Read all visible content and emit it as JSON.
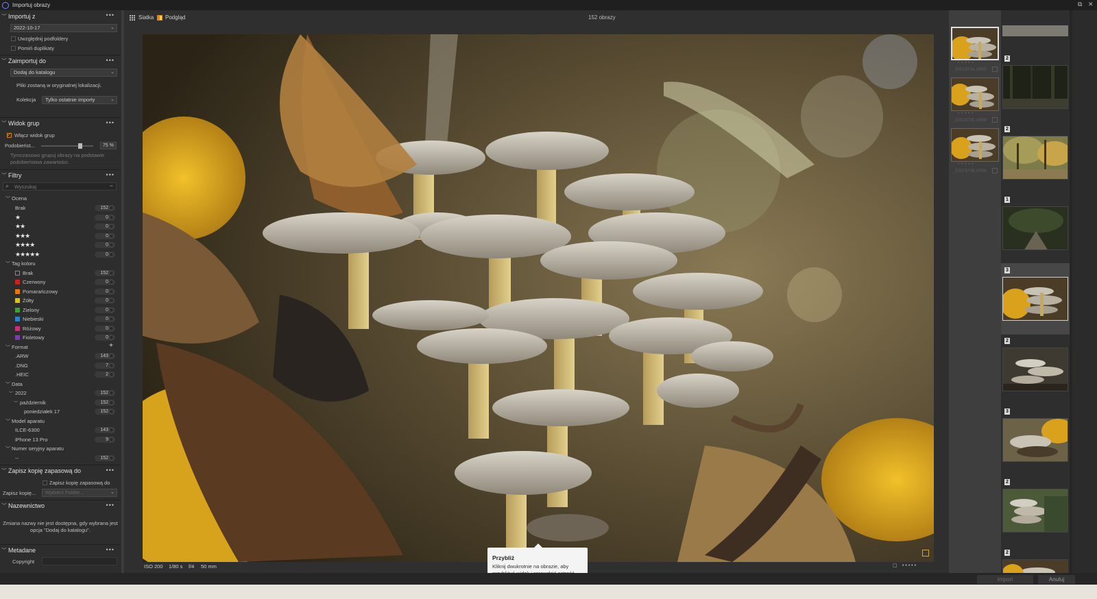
{
  "window": {
    "title": "Importuj obrazy",
    "restore": "⧉",
    "close": "✕"
  },
  "left": {
    "import_from": {
      "title": "Importuj z",
      "date_value": "2022-10-17",
      "include_subfolders": "Uwzględnij podfoldery",
      "skip_duplicates": "Pomiń duplikaty"
    },
    "import_to": {
      "title": "Zaimportuj do",
      "mode_value": "Dodaj do katalogu",
      "note": "Pliki zostaną w oryginalnej lokalizacji.",
      "collection_label": "Kolekcja",
      "collection_value": "Tylko ostatnie importy"
    },
    "group_view": {
      "title": "Widok grup",
      "enable": "Włącz widok grup",
      "similarity_label": "Podobieńst...",
      "similarity_value": "75 %",
      "similarity_level": 0.75,
      "hint": "Tymczasowo grupuj obrazy na podstawie podobieństwa zawartości."
    },
    "filters": {
      "title": "Filtry",
      "search_placeholder": "Wyszukaj",
      "rating": {
        "title": "Ocena",
        "rows": [
          {
            "label": "Brak",
            "count": "152"
          },
          {
            "stars": "★",
            "count": "0"
          },
          {
            "stars": "★★",
            "count": "0"
          },
          {
            "stars": "★★★",
            "count": "0"
          },
          {
            "stars": "★★★★",
            "count": "0"
          },
          {
            "stars": "★★★★★",
            "count": "0"
          }
        ]
      },
      "color_tag": {
        "title": "Tag koloru",
        "rows": [
          {
            "label": "Brak",
            "count": "152",
            "color": "none"
          },
          {
            "label": "Czerwony",
            "count": "0",
            "color": "#c0261e"
          },
          {
            "label": "Pomarańczowy",
            "count": "0",
            "color": "#e07a14"
          },
          {
            "label": "Żółty",
            "count": "0",
            "color": "#d9c21a"
          },
          {
            "label": "Zielony",
            "count": "0",
            "color": "#3aa135"
          },
          {
            "label": "Niebieski",
            "count": "0",
            "color": "#2f7fc8"
          },
          {
            "label": "Różowy",
            "count": "0",
            "color": "#c2337a"
          },
          {
            "label": "Fioletowy",
            "count": "0",
            "color": "#7d3ab2"
          }
        ]
      },
      "format": {
        "title": "Format",
        "rows": [
          {
            "label": ".ARW",
            "count": "143"
          },
          {
            "label": ".DNG",
            "count": "7"
          },
          {
            "label": ".HEIC",
            "count": "2"
          }
        ]
      },
      "date": {
        "title": "Data",
        "year": "2022",
        "year_count": "152",
        "month": "październik",
        "month_count": "152",
        "day": "poniedziałek 17",
        "day_count": "152"
      },
      "camera_model": {
        "title": "Model aparatu",
        "rows": [
          {
            "label": "ILCE-6300",
            "count": "143"
          },
          {
            "label": "iPhone 13 Pro",
            "count": "9"
          }
        ]
      },
      "serial": {
        "title": "Numer seryjny aparatu",
        "rows": [
          {
            "label": "--",
            "count": "152"
          }
        ]
      }
    },
    "backup": {
      "title": "Zapisz kopię zapasową do",
      "check_label": "Zapisz kopię zapasową do",
      "field_label": "Zapisz kopię...",
      "field_value": "Wybierz Folder..."
    },
    "naming": {
      "title": "Nazewnictwo",
      "note": "Zmiana nazwy nie jest dostępna, gdy wybrana jest opcja \"Dodaj do katalogu\"."
    },
    "metadata": {
      "title": "Metadane",
      "copyright_label": "Copyright"
    }
  },
  "toolbar": {
    "grid": "Siatka",
    "preview": "Podgląd",
    "count": "152 obrazy"
  },
  "exif": {
    "iso": "ISO 200",
    "shutter": "1/80 s",
    "aperture": "f/4",
    "focal": "50 mm"
  },
  "tooltip": {
    "title": "Przybliż",
    "body": "Kliknij dwukrotnie na obrazie, aby przybliżyć widok i sprawdzić ostrość."
  },
  "thumbs": [
    {
      "name": "_DSC8734.ARW"
    },
    {
      "name": "_DSC8735.ARW"
    },
    {
      "name": "_DSC8736.ARW"
    }
  ],
  "groups": [
    "2",
    "2",
    "1",
    "3",
    "2",
    "3",
    "2",
    "2"
  ],
  "footer": {
    "import": "Import",
    "cancel": "Anuluj"
  },
  "colors": {
    "accent": "#e08a18",
    "panel": "#2d2d2d",
    "background": "#2b2b2b"
  }
}
